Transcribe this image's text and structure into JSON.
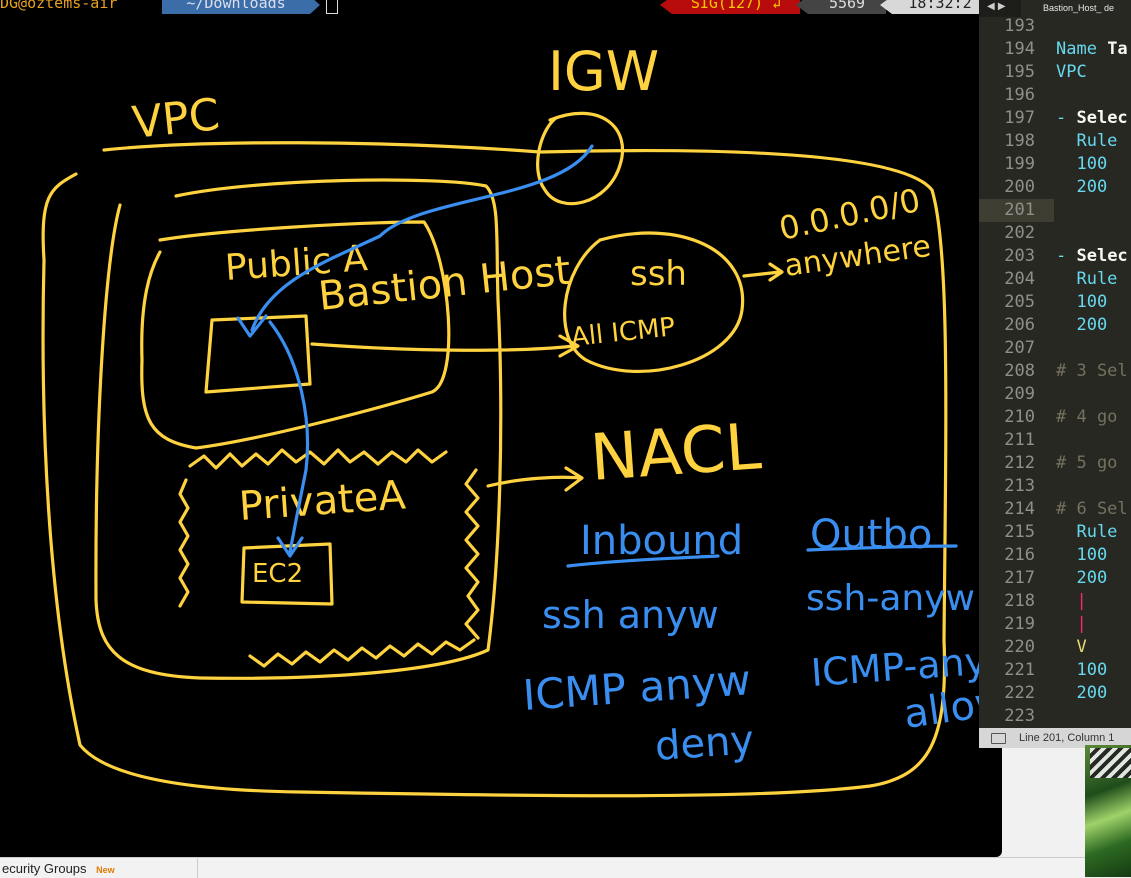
{
  "terminal": {
    "user_host": "DG@oztems-air",
    "directory": "~/Downloads",
    "signal": "SIG(127) ↲",
    "history_number": "5569",
    "clock": "18:32:2"
  },
  "annotations": {
    "vpc": "VPC",
    "igw": "IGW",
    "public": "Public A",
    "bastion": "Bastion Host",
    "ssh": "ssh",
    "all_icmp": "All ICMP",
    "cidr": "0.0.0.0/0",
    "anywhere": "anywhere",
    "private": "PrivateA",
    "ec2": "EC2",
    "nacl": "NACL",
    "inbound": "Inbound",
    "outbound": "Outbo",
    "in_ssh": "ssh anyw",
    "in_icmp": "ICMP anyw",
    "in_deny": "deny",
    "out_ssh": "ssh-anyw",
    "out_icmp": "ICMP-anyw",
    "out_allow": "allow"
  },
  "editor": {
    "tab_title": "Bastion_Host_ de",
    "lines": [
      {
        "n": "193",
        "parts": []
      },
      {
        "n": "194",
        "parts": [
          {
            "c": "tk-key",
            "t": "Name "
          },
          {
            "c": "tk-bold",
            "t": "Ta"
          }
        ]
      },
      {
        "n": "195",
        "parts": [
          {
            "c": "tk-key",
            "t": "VPC"
          }
        ]
      },
      {
        "n": "196",
        "parts": []
      },
      {
        "n": "197",
        "parts": [
          {
            "c": "tk-key",
            "t": "- "
          },
          {
            "c": "tk-bold",
            "t": "Selec"
          }
        ]
      },
      {
        "n": "198",
        "parts": [
          {
            "c": "tk-key",
            "t": "  Rule"
          }
        ]
      },
      {
        "n": "199",
        "parts": [
          {
            "c": "tk-num",
            "t": "  100"
          }
        ]
      },
      {
        "n": "200",
        "parts": [
          {
            "c": "tk-num",
            "t": "  200"
          }
        ]
      },
      {
        "n": "201",
        "parts": []
      },
      {
        "n": "202",
        "parts": []
      },
      {
        "n": "203",
        "parts": [
          {
            "c": "tk-key",
            "t": "- "
          },
          {
            "c": "tk-bold",
            "t": "Selec"
          }
        ]
      },
      {
        "n": "204",
        "parts": [
          {
            "c": "tk-key",
            "t": "  Rule"
          }
        ]
      },
      {
        "n": "205",
        "parts": [
          {
            "c": "tk-num",
            "t": "  100"
          }
        ]
      },
      {
        "n": "206",
        "parts": [
          {
            "c": "tk-num",
            "t": "  200"
          }
        ]
      },
      {
        "n": "207",
        "parts": []
      },
      {
        "n": "208",
        "parts": [
          {
            "c": "tk-cmt",
            "t": "# 3 Sel"
          }
        ]
      },
      {
        "n": "209",
        "parts": []
      },
      {
        "n": "210",
        "parts": [
          {
            "c": "tk-cmt",
            "t": "# 4 go"
          }
        ]
      },
      {
        "n": "211",
        "parts": []
      },
      {
        "n": "212",
        "parts": [
          {
            "c": "tk-cmt",
            "t": "# 5 go"
          }
        ]
      },
      {
        "n": "213",
        "parts": []
      },
      {
        "n": "214",
        "parts": [
          {
            "c": "tk-cmt",
            "t": "# 6 Sel"
          }
        ]
      },
      {
        "n": "215",
        "parts": [
          {
            "c": "tk-key",
            "t": "  Rule"
          }
        ]
      },
      {
        "n": "216",
        "parts": [
          {
            "c": "tk-num",
            "t": "  100"
          }
        ]
      },
      {
        "n": "217",
        "parts": [
          {
            "c": "tk-num",
            "t": "  200"
          }
        ]
      },
      {
        "n": "218",
        "parts": [
          {
            "c": "tk-pipe",
            "t": "  |"
          }
        ]
      },
      {
        "n": "219",
        "parts": [
          {
            "c": "tk-pipe",
            "t": "  |"
          }
        ]
      },
      {
        "n": "220",
        "parts": [
          {
            "c": "tk-v",
            "t": "  V"
          }
        ]
      },
      {
        "n": "221",
        "parts": [
          {
            "c": "tk-num",
            "t": "  100"
          }
        ]
      },
      {
        "n": "222",
        "parts": [
          {
            "c": "tk-num",
            "t": "  200"
          }
        ]
      },
      {
        "n": "223",
        "parts": []
      }
    ],
    "status": "Line 201, Column 1"
  },
  "bottom": {
    "tab_label": "ecurity Groups",
    "new_badge": "New"
  },
  "colors": {
    "ink_yellow": "#ffd23f",
    "ink_blue": "#3a8ef0",
    "signal_red": "#b80b0b",
    "dir_blue": "#3b6ea8"
  }
}
